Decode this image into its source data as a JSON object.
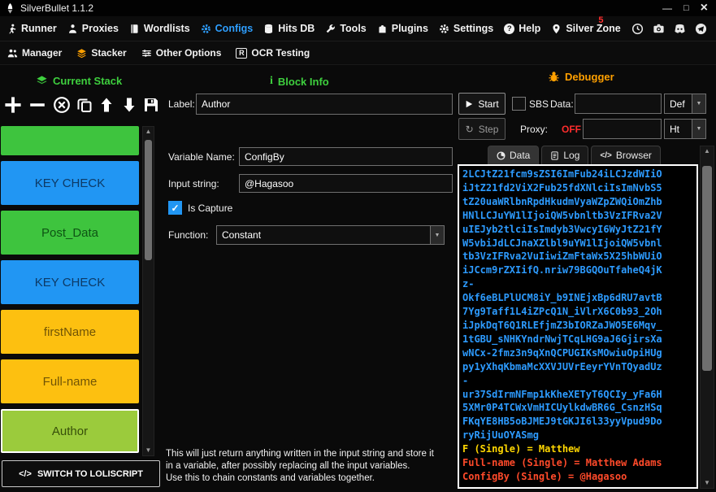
{
  "colors": {
    "accent-blue": "#2e9fff",
    "accent-orange": "#ffa000",
    "accent-green": "#3ecf3e",
    "block-blue": "#2196f3",
    "block-green": "#3ec43e",
    "block-gold": "#fdc010",
    "block-yellowgreen": "#9bcb3c",
    "debug-blue": "#2d9bff",
    "result-yellow": "#ffd700",
    "result-red": "#ff4a2a",
    "off-red": "#ff2d2d"
  },
  "titlebar": {
    "title": "SilverBullet 1.1.2",
    "minimize": "—",
    "maximize": "□",
    "close": "×"
  },
  "menubar": {
    "items": [
      {
        "label": "Runner"
      },
      {
        "label": "Proxies"
      },
      {
        "label": "Wordlists"
      },
      {
        "label": "Configs"
      },
      {
        "label": "Hits DB"
      },
      {
        "label": "Tools"
      },
      {
        "label": "Plugins"
      },
      {
        "label": "Settings"
      },
      {
        "label": "Help"
      },
      {
        "label": "Silver Zone",
        "badge": "5"
      }
    ]
  },
  "subnav": {
    "items": [
      {
        "label": "Manager"
      },
      {
        "label": "Stacker"
      },
      {
        "label": "Other Options"
      },
      {
        "label": "OCR Testing"
      }
    ]
  },
  "sections": {
    "current_stack": "Current Stack",
    "block_info": "Block Info",
    "debugger": "Debugger"
  },
  "stack": {
    "blocks": [
      {
        "label": "",
        "type": "green"
      },
      {
        "label": "KEY CHECK",
        "type": "blue"
      },
      {
        "label": "Post_Data",
        "type": "green"
      },
      {
        "label": "KEY CHECK",
        "type": "blue"
      },
      {
        "label": "firstName",
        "type": "gold"
      },
      {
        "label": "Full-name",
        "type": "gold"
      },
      {
        "label": "Author",
        "type": "yellowgreen",
        "selected": true
      }
    ],
    "switch_button": "SWITCH TO LOLISCRIPT",
    "switch_icon": "</>"
  },
  "block_info": {
    "label_caption": "Label:",
    "label_value": "Author",
    "variable_caption": "Variable Name:",
    "variable_value": "ConfigBy",
    "input_caption": "Input string:",
    "input_value": "@Hagasoo",
    "capture_caption": "Is Capture",
    "function_caption": "Function:",
    "function_value": "Constant",
    "description_lines": [
      "This will just return anything written in the input string and store it",
      "in a variable, after possibly replacing all the input variables.",
      "Use this to chain constants and variables together."
    ]
  },
  "debugger": {
    "start": "Start",
    "sbs": "SBS",
    "data_caption": "Data:",
    "data_value": "",
    "data_select": "Def",
    "step": "Step",
    "proxy_caption": "Proxy:",
    "proxy_status": "OFF",
    "proxy_value": "",
    "proxy_select": "Ht",
    "tabs": [
      {
        "label": "Data"
      },
      {
        "label": "Log"
      },
      {
        "label": "Browser"
      }
    ],
    "log": [
      "2LCJtZ21fcm9sZSI6ImFub24iLCJzdWIiO",
      "iJtZ21fd2ViX2Fub25fdXNlciIsImNvbS5",
      "tZ20uaWRlbnRpdHkudmVyaWZpZWQiOmZhb",
      "HNlLCJuYW1lIjoiQW5vbnltb3VzIFRva2V",
      "uIEJyb2tlciIsImdyb3VwcyI6WyJtZ21fY",
      "W5vbiJdLCJnaXZlbl9uYW1lIjoiQW5vbnl",
      "tb3VzIFRva2VuIiwiZmFtaWx5X25hbWUiO",
      "iJCcm9rZXIifQ.nriw79BGQOuTfaheQ4jK",
      "z-",
      "Okf6eBLPlUCM8iY_b9INEjxBp6dRU7avtB",
      "7Yg9Taff1L4iZPcQ1N_iVlrX6C0b93_2Oh",
      "iJpkDqT6Q1RLEfjmZ3bIORZaJWO5E6Mqv_",
      "1tGBU_sNHKYndrNwjTCqLHG9aJ6GjirsXa",
      "wNCx-2fmz3n9qXnQCPUGIKsMOwiuOpiHUg",
      "py1yXhqKbmaMcXXVJUVrEeyrYVnTQyadUz",
      "-",
      "ur37SdIrmNFmp1kKheXETyT6QCIy_yFa6H",
      "5XMr0P4TCWxVmHICUylkdwBR6G_CsnzHSq",
      "FKqYE8HB5oBJMEJ9tGKJI6l33yyVpud9Do",
      "ryRijUuOYASmg",
      {
        "text": "F (Single) = Matthew",
        "color": "#ffd700"
      },
      {
        "text": "Full-name (Single) = Matthew Adams",
        "color": "#ff4a2a"
      },
      {
        "text": "ConfigBy (Single) = @Hagasoo",
        "color": "#ff4a2a"
      }
    ]
  },
  "icons": {
    "check": "✓",
    "dropdown_arrow": "▼",
    "up_arrow": "▲",
    "down_arrow": "▼",
    "step": "↻",
    "code": "</>",
    "info": "i",
    "question": "?",
    "ocr_r": "R"
  }
}
